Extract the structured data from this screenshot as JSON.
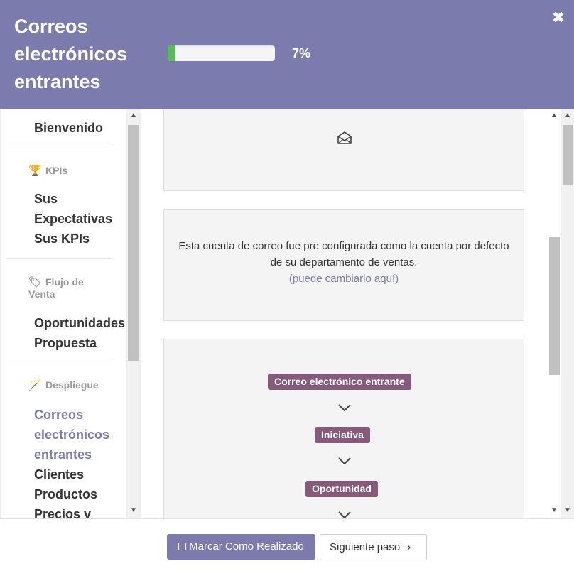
{
  "header": {
    "title": "Correos electrónicos entrantes",
    "progress_percent": 7,
    "progress_label": "7%",
    "close_icon": "close-icon"
  },
  "sidebar": {
    "welcome": "Bienvenido",
    "sections": [
      {
        "title": "KPIs",
        "icon": "trophy-icon",
        "items": [
          "Sus Expectativas",
          "Sus KPIs"
        ]
      },
      {
        "title": "Flujo de Venta",
        "icon": "tag-icon",
        "items": [
          "Oportunidades",
          "Propuesta"
        ]
      },
      {
        "title": "Despliegue",
        "icon": "magic-wand-icon",
        "items": [
          "Correos electrónicos entrantes",
          "Clientes",
          "Productos",
          "Precios y"
        ]
      }
    ]
  },
  "main": {
    "icon": "envelope-open-icon",
    "description": "Esta cuenta de correo fue pre configurada como la cuenta por defecto de su departamento de ventas.",
    "change_link": "(puede cambiarlo aquí)",
    "flow": [
      "Correo electrónico entrante",
      "Iniciativa",
      "Oportunidad"
    ]
  },
  "footer": {
    "mark_done_label": "Marcar Como Realizado",
    "next_step_label": "Siguiente paso"
  },
  "colors": {
    "header_bg": "#7c7bad",
    "accent": "#7c7bad",
    "badge": "#875a7b",
    "progress": "#5cb85c"
  }
}
